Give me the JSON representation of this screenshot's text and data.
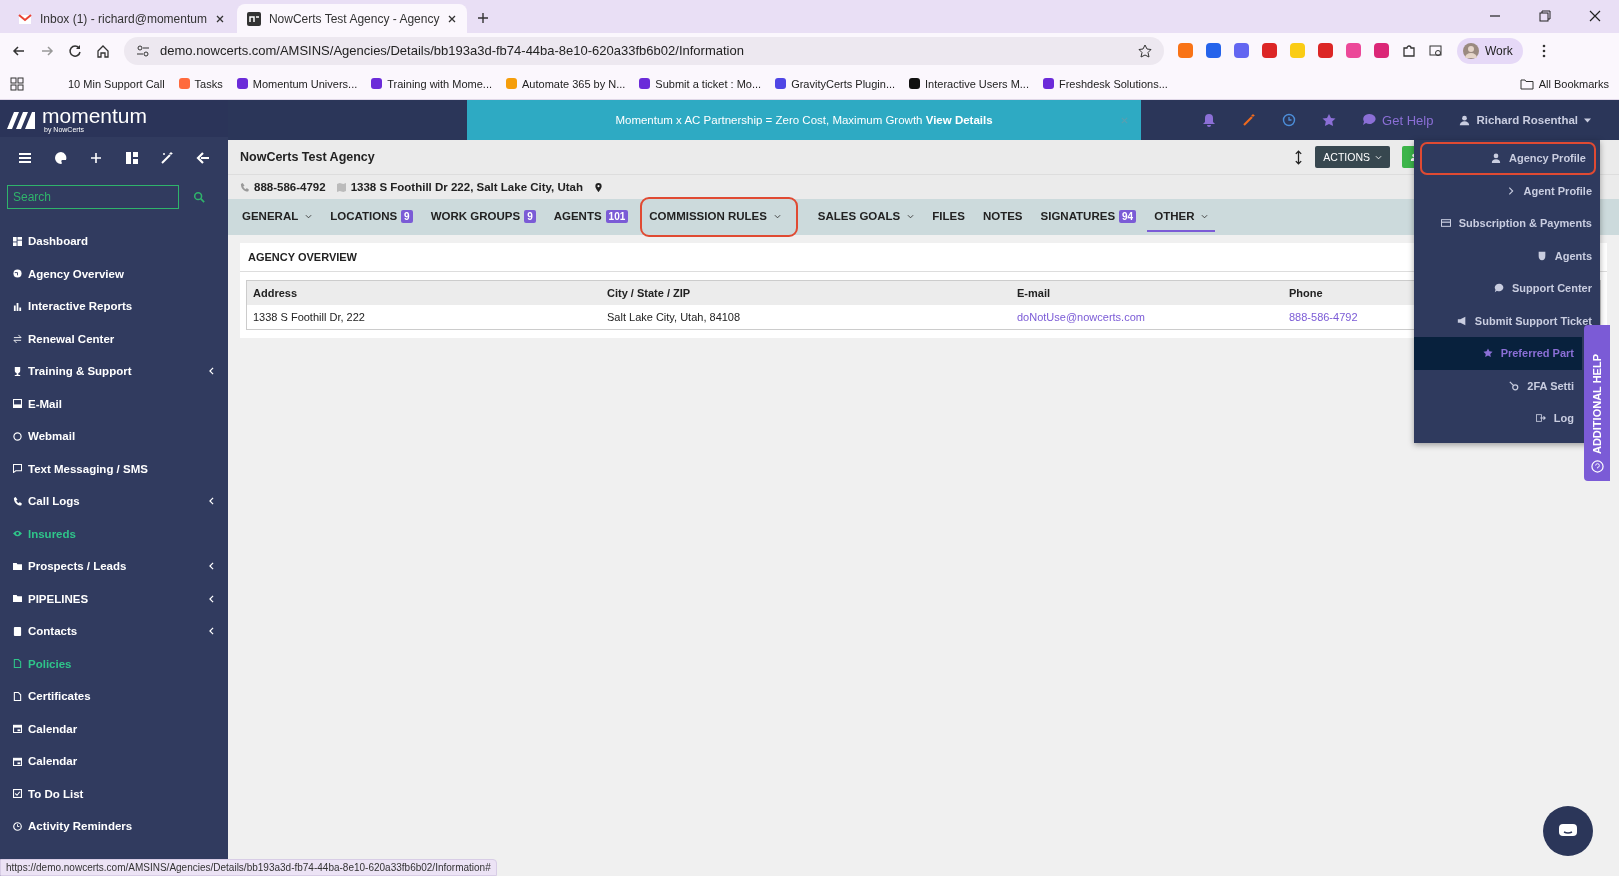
{
  "browser": {
    "tabs": [
      {
        "title": "Inbox (1) - richard@momentum",
        "selected": false
      },
      {
        "title": "NowCerts Test Agency - Agency",
        "selected": true
      }
    ],
    "url": "demo.nowcerts.com/AMSINS/Agencies/Details/bb193a3d-fb74-44ba-8e10-620a33fb6b02/Information",
    "profile": "Work",
    "bookmarks": [
      {
        "label": "10 Min Support Call"
      },
      {
        "label": "Tasks",
        "color": "#ff6a3d"
      },
      {
        "label": "Momentum Univers...",
        "color": "#6b2bd9"
      },
      {
        "label": "Training with Mome...",
        "color": "#6b2bd9"
      },
      {
        "label": "Automate 365 by N...",
        "color": "#f59e0b"
      },
      {
        "label": "Submit a ticket : Mo...",
        "color": "#6b2bd9"
      },
      {
        "label": "GravityCerts Plugin...",
        "color": "#4f46e5"
      },
      {
        "label": "Interactive Users M...",
        "color": "#111111"
      },
      {
        "label": "Freshdesk Solutions...",
        "color": "#6b2bd9"
      }
    ],
    "all_bookmarks": "All Bookmarks",
    "extensions": [
      {
        "color": "#f97316"
      },
      {
        "color": "#2563eb"
      },
      {
        "color": "#6366f1"
      },
      {
        "color": "#dc2626"
      },
      {
        "color": "#facc15"
      },
      {
        "color": "#dc2626"
      },
      {
        "color": "#ec4899"
      },
      {
        "color": "#db2777"
      }
    ],
    "status_url": "https://demo.nowcerts.com/AMSINS/Agencies/Details/bb193a3d-fb74-44ba-8e10-620a33fb6b02/Information#"
  },
  "app": {
    "brand": "momentum",
    "brand_sub": "by NowCerts",
    "search": {
      "placeholder": "Search"
    },
    "sidebar": [
      {
        "label": "Dashboard",
        "highlighted": false,
        "expandable": false
      },
      {
        "label": "Agency Overview",
        "highlighted": false,
        "expandable": false
      },
      {
        "label": "Interactive Reports",
        "highlighted": false,
        "expandable": false
      },
      {
        "label": "Renewal Center",
        "highlighted": false,
        "expandable": false
      },
      {
        "label": "Training & Support",
        "highlighted": false,
        "expandable": true
      },
      {
        "label": "E-Mail",
        "highlighted": false,
        "expandable": false
      },
      {
        "label": "Webmail",
        "highlighted": false,
        "expandable": false
      },
      {
        "label": "Text Messaging / SMS",
        "highlighted": false,
        "expandable": false
      },
      {
        "label": "Call Logs",
        "highlighted": false,
        "expandable": true
      },
      {
        "label": "Insureds",
        "highlighted": true,
        "expandable": false
      },
      {
        "label": "Prospects / Leads",
        "highlighted": false,
        "expandable": true
      },
      {
        "label": "PIPELINES",
        "highlighted": false,
        "expandable": true
      },
      {
        "label": "Contacts",
        "highlighted": false,
        "expandable": true
      },
      {
        "label": "Policies",
        "highlighted": true,
        "expandable": false
      },
      {
        "label": "Certificates",
        "highlighted": false,
        "expandable": false
      },
      {
        "label": "Calendar",
        "highlighted": false,
        "expandable": false
      },
      {
        "label": "Calendar",
        "highlighted": false,
        "expandable": false
      },
      {
        "label": "To Do List",
        "highlighted": false,
        "expandable": false
      },
      {
        "label": "Activity Reminders",
        "highlighted": false,
        "expandable": false
      }
    ],
    "banner": {
      "text": "Momentum x AC Partnership = Zero Cost, Maximum Growth ",
      "link": "View Details"
    },
    "get_help": "Get Help",
    "user": "Richard Rosenthal",
    "agency_name": "NowCerts Test Agency",
    "actions": "ACTIONS",
    "phone": "888-586-4792",
    "address": "1338 S Foothill Dr 222, Salt Lake City, Utah",
    "tabs": [
      {
        "label": "GENERAL",
        "dropdown": true,
        "selected": false,
        "annotated": false
      },
      {
        "label": "LOCATIONS",
        "badge": "9",
        "dropdown": false,
        "selected": false,
        "annotated": false
      },
      {
        "label": "WORK GROUPS",
        "badge": "9",
        "dropdown": false,
        "selected": false,
        "annotated": false
      },
      {
        "label": "AGENTS",
        "badge": "101",
        "dropdown": false,
        "selected": false,
        "annotated": false
      },
      {
        "label": "COMMISSION RULES",
        "dropdown": true,
        "selected": false,
        "annotated": true
      },
      {
        "label": "SALES GOALS",
        "dropdown": true,
        "selected": false,
        "annotated": false
      },
      {
        "label": "FILES",
        "dropdown": false,
        "selected": false,
        "annotated": false
      },
      {
        "label": "NOTES",
        "dropdown": false,
        "selected": false,
        "annotated": false
      },
      {
        "label": "SIGNATURES",
        "badge": "94",
        "dropdown": false,
        "selected": false,
        "annotated": false
      },
      {
        "label": "OTHER",
        "dropdown": true,
        "selected": true,
        "annotated": false
      }
    ],
    "overview": {
      "title": "AGENCY OVERVIEW",
      "columns": [
        "Address",
        "City / State / ZIP",
        "E-mail",
        "Phone"
      ],
      "rows": [
        [
          "1338 S Foothill Dr, 222",
          "Salt Lake City, Utah, 84108",
          "doNotUse@nowcerts.com",
          "888-586-4792"
        ]
      ]
    },
    "user_menu": [
      {
        "label": "Agency Profile",
        "highlighted": false,
        "annotated": true
      },
      {
        "label": "Agent Profile",
        "highlighted": false,
        "annotated": false
      },
      {
        "label": "Subscription & Payments",
        "highlighted": false,
        "annotated": false
      },
      {
        "label": "Agents",
        "highlighted": false,
        "annotated": false
      },
      {
        "label": "Support Center",
        "highlighted": false,
        "annotated": false
      },
      {
        "label": "Submit Support Ticket",
        "highlighted": false,
        "annotated": false
      },
      {
        "label": "Preferred Part",
        "highlighted": true,
        "annotated": false
      },
      {
        "label": "2FA Setti",
        "highlighted": false,
        "annotated": false
      },
      {
        "label": "Log",
        "highlighted": false,
        "annotated": false
      }
    ],
    "help_tab": "ADDITIONAL HELP"
  }
}
